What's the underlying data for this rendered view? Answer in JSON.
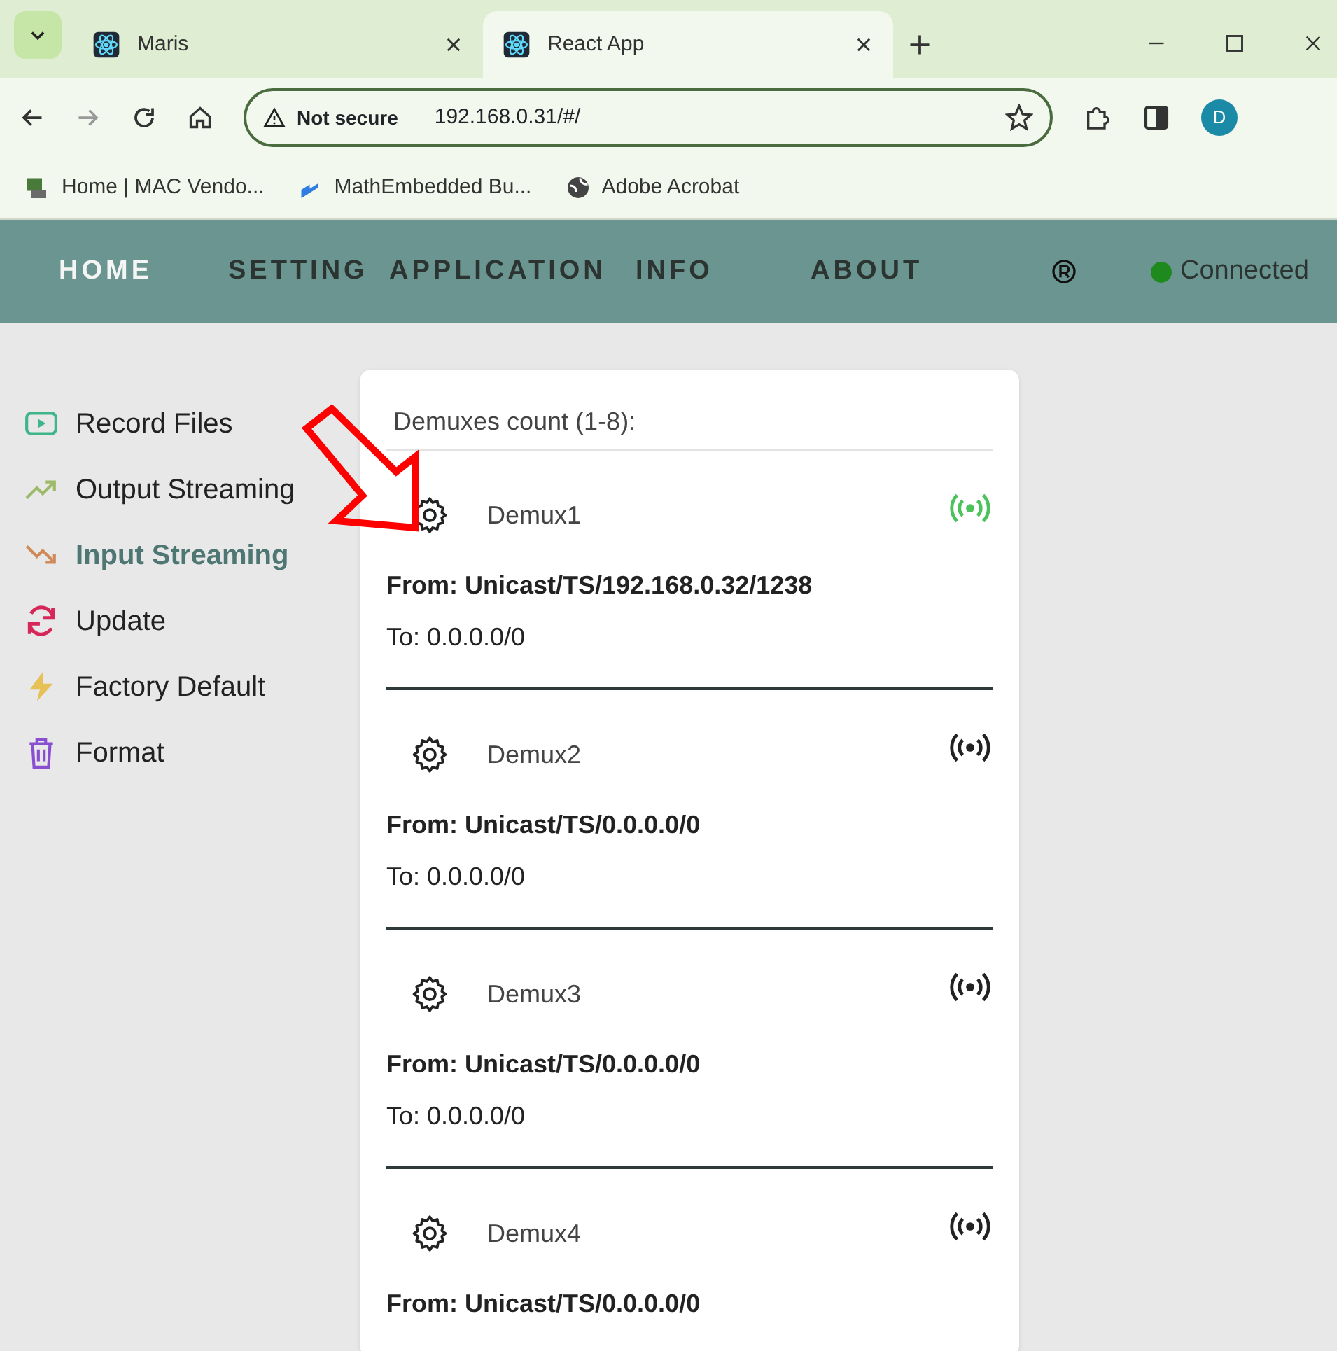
{
  "browser": {
    "tabs": [
      {
        "title": "Maris",
        "selected": false
      },
      {
        "title": "React App",
        "selected": true
      }
    ],
    "address": {
      "security": "Not secure",
      "url": "192.168.0.31/#/"
    },
    "profile": "D",
    "bookmarks": [
      {
        "label": "Home | MAC Vendo..."
      },
      {
        "label": "MathEmbedded Bu..."
      },
      {
        "label": "Adobe Acrobat"
      }
    ]
  },
  "nav": {
    "items": [
      {
        "label": "HOME",
        "selected": true
      },
      {
        "label": "SETTING",
        "selected": false
      },
      {
        "label": "APPLICATION",
        "selected": false
      },
      {
        "label": "INFO",
        "selected": false
      },
      {
        "label": "ABOUT",
        "selected": false
      }
    ],
    "status": {
      "label": "Connected",
      "color": "#1e8a1e"
    }
  },
  "sidebar": {
    "items": [
      {
        "label": "Record Files",
        "kind": "record",
        "selected": false
      },
      {
        "label": "Output Streaming",
        "kind": "output",
        "selected": false
      },
      {
        "label": "Input Streaming",
        "kind": "input",
        "selected": true
      },
      {
        "label": "Update",
        "kind": "update",
        "selected": false
      },
      {
        "label": "Factory Default",
        "kind": "factory",
        "selected": false
      },
      {
        "label": "Format",
        "kind": "format",
        "selected": false
      }
    ]
  },
  "panel": {
    "title": "Demuxes count (1-8):",
    "demuxes": [
      {
        "name": "Demux1",
        "active": true,
        "from": "From: Unicast/TS/192.168.0.32/1238",
        "to": "To: 0.0.0.0/0"
      },
      {
        "name": "Demux2",
        "active": false,
        "from": "From: Unicast/TS/0.0.0.0/0",
        "to": "To: 0.0.0.0/0"
      },
      {
        "name": "Demux3",
        "active": false,
        "from": "From: Unicast/TS/0.0.0.0/0",
        "to": "To: 0.0.0.0/0"
      },
      {
        "name": "Demux4",
        "active": false,
        "from": "From: Unicast/TS/0.0.0.0/0"
      }
    ]
  },
  "annotation": {
    "kind": "arrow"
  }
}
